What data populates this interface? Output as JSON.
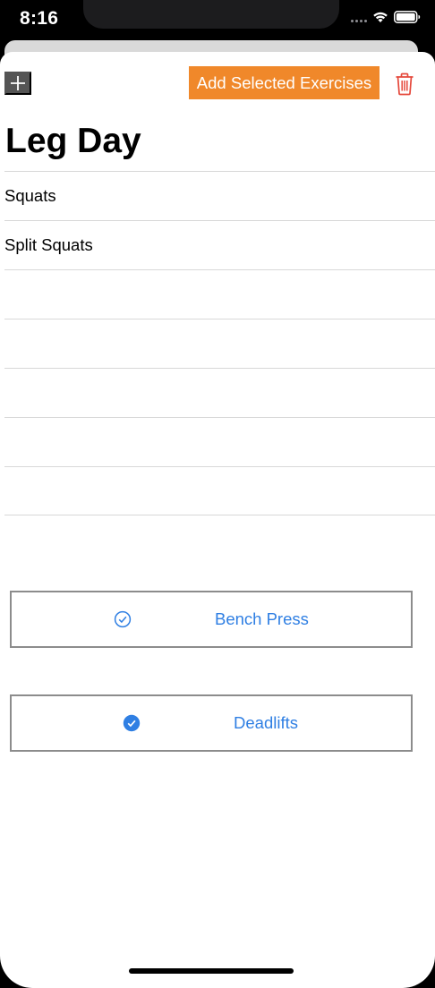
{
  "status": {
    "time": "8:16"
  },
  "toolbar": {
    "add_selected_label": "Add Selected Exercises"
  },
  "workout": {
    "title": "Leg Day"
  },
  "exercises": [
    {
      "label": "Squats"
    },
    {
      "label": "Split Squats"
    },
    {
      "label": ""
    },
    {
      "label": ""
    },
    {
      "label": ""
    },
    {
      "label": ""
    },
    {
      "label": ""
    }
  ],
  "options": [
    {
      "label": "Bench Press",
      "selected": false
    },
    {
      "label": "Deadlifts",
      "selected": true
    }
  ],
  "colors": {
    "accent": "#f0882a",
    "link": "#2f7fe3",
    "destructive": "#e5483b"
  },
  "icons": {
    "add": "plus-icon",
    "delete": "trash-icon",
    "unchecked": "checkmark-circle-outline-icon",
    "checked": "checkmark-circle-filled-icon"
  }
}
